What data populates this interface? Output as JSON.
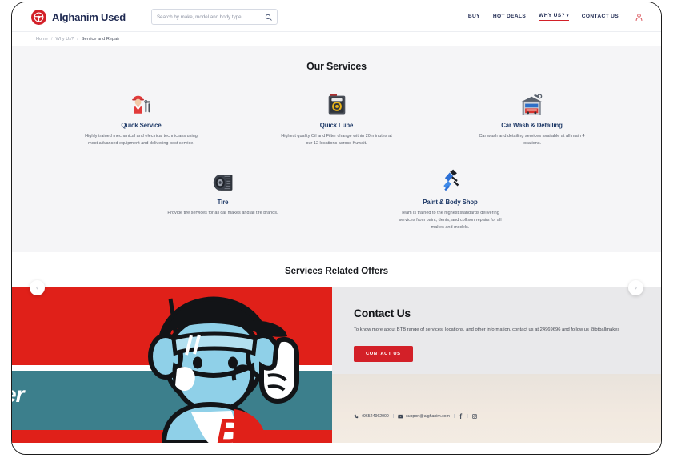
{
  "header": {
    "brand_name": "Alghanim Used",
    "brand_logo_icon": "steering-wheel-icon",
    "search": {
      "placeholder": "Search by make, model and body type",
      "value": "",
      "icon": "search-icon"
    },
    "nav": [
      {
        "label": "BUY",
        "active": false,
        "has_dropdown": false
      },
      {
        "label": "HOT DEALS",
        "active": false,
        "has_dropdown": false
      },
      {
        "label": "WHY US?",
        "active": true,
        "has_dropdown": true
      },
      {
        "label": "CONTACT US",
        "active": false,
        "has_dropdown": false
      }
    ],
    "nav_caret": "▾",
    "account_icon": "user-account-icon"
  },
  "breadcrumb": {
    "separator": "/",
    "items": [
      {
        "label": "Home",
        "current": false
      },
      {
        "label": "Why Us?",
        "current": false
      },
      {
        "label": "Service and Repair",
        "current": true
      }
    ]
  },
  "services": {
    "title": "Our Services",
    "row_1": [
      {
        "icon": "mechanic-worker-icon",
        "name": "Quick Service",
        "description": "Highly trained mechanical and electrical technicians using most advanced equipment and delivering best service."
      },
      {
        "icon": "oil-can-icon",
        "name": "Quick Lube",
        "description": "Highest quality Oil and Filter change within 20 minutes at our 12 locations across Kuwait."
      },
      {
        "icon": "garage-car-wash-icon",
        "name": "Car Wash & Detailing",
        "description": "Car wash and detailing services available at all main 4 locations."
      }
    ],
    "row_2": [
      {
        "icon": "tire-icon",
        "name": "Tire",
        "description": "Provide tire services for all car makes and all tire brands."
      },
      {
        "icon": "spray-gun-icon",
        "name": "Paint & Body Shop",
        "description": "Team is trained to the highest standards delivering services from paint, dents, and collison repairs for all makes and models."
      }
    ]
  },
  "offers": {
    "title": "Services Related Offers",
    "prev_arrow": "‹",
    "next_arrow": "›",
    "prev_icon": "chevron-left-icon",
    "next_icon": "chevron-right-icon",
    "promo_slide": {
      "icon": "mascot-illustration",
      "partial_word": "er"
    }
  },
  "contact": {
    "heading": "Contact Us",
    "body": "To know more about BTB range of services, locations, and other information, contact us at 24969696 and follow us @btballmakes",
    "cta_label": "CONTACT US",
    "phone": "+96524962000",
    "phone_icon": "phone-icon",
    "email": "support@alghanim.com",
    "email_icon": "envelope-icon",
    "facebook_icon": "facebook-icon",
    "facebook_glyph": "f",
    "instagram_icon": "instagram-icon",
    "separator": "|"
  },
  "colors": {
    "brand_red": "#d32028",
    "promo_red": "#e02019",
    "navy": "#1f2a52",
    "service_heading": "#1f3a68",
    "section_bg": "#f5f5f7",
    "teal": "#3c7f8c"
  }
}
